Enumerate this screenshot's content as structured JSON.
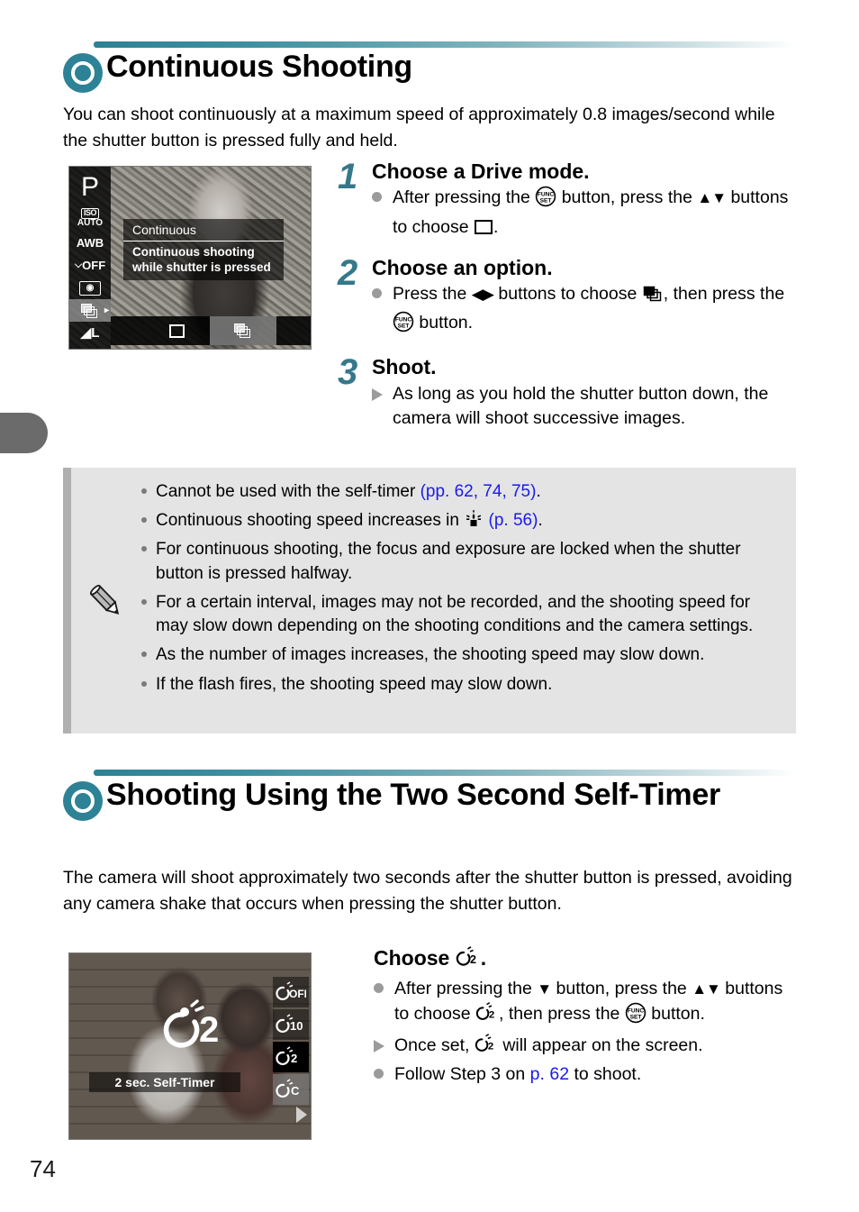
{
  "page": {
    "number": "74"
  },
  "section1": {
    "title": "Continuous Shooting",
    "intro": "You can shoot continuously at a maximum speed of approximately 0.8 images/second while the shutter button is pressed fully and held.",
    "screenshot": {
      "mode_icon": "P",
      "iso_label_top": "ISO",
      "iso_label_bottom": "AUTO",
      "wb_label": "AWB",
      "flash_label": "OFF",
      "panel_title": "Continuous",
      "panel_desc_line1": "Continuous shooting",
      "panel_desc_line2": "while shutter is pressed",
      "quality_label": "L"
    },
    "steps": [
      {
        "num": "1",
        "title": "Choose a Drive mode.",
        "bullets": [
          {
            "type": "dot",
            "text_a": "After pressing the",
            "icon_a": "func-set-button-icon",
            "text_b": "button, press the",
            "icon_b": "up-down-arrows-icon",
            "text_c": "buttons to choose",
            "icon_c": "single-shot-square-icon",
            "text_d": "."
          }
        ]
      },
      {
        "num": "2",
        "title": "Choose an option.",
        "bullets": [
          {
            "type": "dot",
            "text_a": "Press the",
            "icon_a": "left-right-arrows-icon",
            "text_b": "buttons to choose",
            "icon_b": "continuous-drive-icon",
            "text_c": ", then press the",
            "icon_c": "func-set-button-icon",
            "text_d": "button."
          }
        ]
      },
      {
        "num": "3",
        "title": "Shoot.",
        "bullets": [
          {
            "type": "triangle",
            "text_a": "As long as you hold the shutter button down, the camera will shoot successive images."
          }
        ]
      }
    ]
  },
  "notes": {
    "icon": "pencil-icon",
    "items": [
      {
        "text_a": "Cannot be used with the self-timer ",
        "link": "(pp. 62, 74, 75)",
        "text_b": "."
      },
      {
        "text_a": "Continuous shooting speed increases in ",
        "icon": "low-light-candle-icon",
        "text_mid": " ",
        "link": "(p. 56)",
        "text_b": "."
      },
      {
        "text_a": "For continuous shooting, the focus and exposure are locked when the shutter button is pressed halfway."
      },
      {
        "text_a": "For a certain interval, images may not be recorded, and the shooting speed for may slow down depending on the shooting conditions and the camera settings."
      },
      {
        "text_a": "As the number of images increases, the shooting speed may slow down."
      },
      {
        "text_a": "If the flash fires, the shooting speed may slow down."
      }
    ]
  },
  "section2": {
    "title": "Shooting Using the Two Second Self-Timer",
    "intro": "The camera will shoot approximately two seconds after the shutter button is pressed, avoiding any camera shake that occurs when pressing the shutter button.",
    "screenshot": {
      "big_timer_icon": "self-timer-2sec-large-icon",
      "label": "2 sec. Self-Timer",
      "options": [
        "self-timer-off-icon",
        "self-timer-10sec-icon",
        "self-timer-2sec-icon",
        "self-timer-custom-icon"
      ],
      "selected_index": 2
    },
    "heading": {
      "text_a": "Choose",
      "icon": "self-timer-2sec-icon",
      "text_b": "."
    },
    "bullets": [
      {
        "type": "dot",
        "text_a": "After pressing the",
        "icon_a": "down-arrow-icon",
        "text_b": "button, press the",
        "icon_b": "up-down-arrows-icon",
        "text_c": "buttons to choose",
        "icon_c": "self-timer-2sec-icon",
        "text_d": ", then press the",
        "icon_d": "func-set-button-icon",
        "text_e": "button."
      },
      {
        "type": "triangle",
        "text_a": "Once set,",
        "icon_a": "self-timer-2sec-icon",
        "text_b": "will appear on the screen."
      },
      {
        "type": "dot",
        "text_a": "Follow Step 3 on ",
        "link": "p. 62",
        "text_b": " to shoot."
      }
    ]
  },
  "colors": {
    "accent_teal": "#2d8296",
    "step_number_teal": "#35788a",
    "link_blue": "#1a1aee",
    "notes_background": "#e4e4e4",
    "notes_bar": "#b0b0b0",
    "chapter_tab": "#6b6b6b",
    "bullet_gray": "#9b9b9b"
  }
}
